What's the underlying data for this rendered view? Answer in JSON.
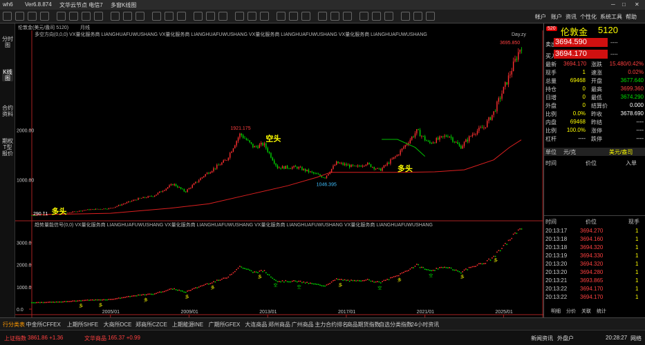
{
  "app": {
    "name": "wh6",
    "version": "Ver6.8.874",
    "menu": [
      "文华云节点 电信7",
      "多窗K线图"
    ],
    "window_controls": [
      "─",
      "□",
      "✕"
    ]
  },
  "toolbar": {
    "right_items": [
      "帐户",
      "账户",
      "资讯",
      "个性化",
      "系统工具",
      "帮助"
    ]
  },
  "left_tabs": [
    {
      "label": "分时图",
      "active": false
    },
    {
      "label": "K线图",
      "active": true
    },
    {
      "label": "合约资料",
      "active": false
    },
    {
      "label": "期权T型报价",
      "active": false
    }
  ],
  "chart_header": {
    "instrument": "伦敦金(美元/盎司 5120)",
    "period": "月线",
    "indicator_line": "多空方向(0,0,0)  VX量化服务商  LIANGHUAFUWUSHANG  VX量化服务商  LIANGHUAFUWUSHANG  VX量化服务商  LIANGHUAFUWUSHANG  VX量化服务商  LIANGHUAFUWUSHANG",
    "day_label": "Day.zy",
    "sub_indicator_line": "趋势量能信号(0,0)  VX量化服务商  LIANGHUAFUWUSHANG  VX量化服务商  LIANGHUAFUWUSHANG  VX量化服务商  LIANGHUAFUWUSHANG  VX量化服务商  LIANGHUAFUWUSHANG"
  },
  "chart_data": {
    "type": "candlestick",
    "title": "伦敦金 月线",
    "x_ticks": [
      "2005/01",
      "2009/01",
      "2013/01",
      "2017/01",
      "2021/01",
      "2025/01"
    ],
    "main_y_ticks": [
      1000.0,
      2000.0
    ],
    "sub_y_ticks": [
      0.0,
      1000.0,
      2000.0,
      3000.0
    ],
    "main_ylim": [
      290,
      3800
    ],
    "sub_ylim": [
      0,
      3600
    ],
    "x_range_years": [
      2001.0,
      2025.9
    ],
    "anchors": [
      [
        2001.0,
        290
      ],
      [
        2002.5,
        320
      ],
      [
        2003.8,
        400
      ],
      [
        2005.0,
        430
      ],
      [
        2006.4,
        620
      ],
      [
        2007.2,
        680
      ],
      [
        2008.2,
        920
      ],
      [
        2008.8,
        760
      ],
      [
        2009.8,
        1100
      ],
      [
        2010.9,
        1400
      ],
      [
        2011.6,
        1921.175
      ],
      [
        2012.3,
        1650
      ],
      [
        2012.8,
        1720
      ],
      [
        2013.5,
        1250
      ],
      [
        2014.5,
        1250
      ],
      [
        2015.9,
        1046.395
      ],
      [
        2016.5,
        1340
      ],
      [
        2017.5,
        1250
      ],
      [
        2018.0,
        1330
      ],
      [
        2018.7,
        1190
      ],
      [
        2019.6,
        1500
      ],
      [
        2020.6,
        1980
      ],
      [
        2021.2,
        1730
      ],
      [
        2022.2,
        1900
      ],
      [
        2022.8,
        1650
      ],
      [
        2023.5,
        1950
      ],
      [
        2024.0,
        2050
      ],
      [
        2024.5,
        2350
      ],
      [
        2025.2,
        3000
      ],
      [
        2025.7,
        3500
      ],
      [
        2025.9,
        3694.17
      ]
    ],
    "trailing_line": [
      [
        2001.0,
        300
      ],
      [
        2005.0,
        330
      ],
      [
        2008.0,
        430
      ],
      [
        2010.0,
        520
      ],
      [
        2012.0,
        700
      ],
      [
        2014.0,
        880
      ],
      [
        2015.5,
        1050
      ],
      [
        2016.2,
        1150
      ],
      [
        2020.0,
        1150
      ],
      [
        2021.5,
        1160
      ],
      [
        2023.0,
        1200
      ],
      [
        2024.5,
        1400
      ],
      [
        2025.3,
        1650
      ],
      [
        2025.9,
        1800
      ]
    ],
    "short_line": [
      [
        2018.8,
        1810
      ],
      [
        2019.6,
        1810
      ],
      [
        2020.5,
        1650
      ],
      [
        2021.0,
        1470
      ]
    ],
    "annotations": {
      "high_label": "1921.175",
      "low_label": "1046.395",
      "low_start_label": "290 †1",
      "peak_label": "3695.850",
      "short_signal": "空头",
      "long_signal_1": "多头",
      "long_signal_2": "多头"
    },
    "sub_markers": [
      "多",
      "空"
    ]
  },
  "quote": {
    "badge": "520",
    "name": "伦敦金",
    "code": "5120",
    "sell_label": "卖出",
    "sell_price": "3694.590",
    "sell_vol": "----",
    "buy_label": "买入",
    "buy_price": "3694.170",
    "buy_vol": "----",
    "rows": [
      {
        "l1": "最新",
        "v1": "3694.170",
        "c1": "#ff4040",
        "l2": "涨跌",
        "v2": "15.480/0.42%",
        "c2": "#ff4040"
      },
      {
        "l1": "现手",
        "v1": "1",
        "c1": "#ffff00",
        "l2": "速涨",
        "v2": "0.02%",
        "c2": "#ff4040"
      },
      {
        "l1": "总量",
        "v1": "69468",
        "c1": "#ffff00",
        "l2": "开盘",
        "v2": "3677.640",
        "c2": "#00e000"
      },
      {
        "l1": "持仓",
        "v1": "0",
        "c1": "#ffff00",
        "l2": "最高",
        "v2": "3699.360",
        "c2": "#ff4040"
      },
      {
        "l1": "日增",
        "v1": "0",
        "c1": "#ffff00",
        "l2": "最低",
        "v2": "3674.290",
        "c2": "#00e000"
      },
      {
        "l1": "外盘",
        "v1": "0",
        "c1": "#ffff00",
        "l2": "结算价",
        "v2": "0.000",
        "c2": "#ffffff"
      },
      {
        "l1": "比例",
        "v1": "0.0%",
        "c1": "#ffff00",
        "l2": "昨收",
        "v2": "3678.690",
        "c2": "#ffffff"
      },
      {
        "l1": "内盘",
        "v1": "69468",
        "c1": "#ffff00",
        "l2": "昨结",
        "v2": "----",
        "c2": "#ffffff"
      },
      {
        "l1": "比例",
        "v1": "100.0%",
        "c1": "#ffff00",
        "l2": "涨停",
        "v2": "----",
        "c2": "#ffffff"
      },
      {
        "l1": "杠杆",
        "v1": "----",
        "c1": "#ffffff",
        "l2": "跌停",
        "v2": "----",
        "c2": "#ffffff"
      }
    ],
    "unit_label": "单位",
    "unit_value": "元/克",
    "unit_value2": "美元/盎司",
    "panel_headers": [
      "时间",
      "价位",
      "入单"
    ],
    "tick_headers": [
      "时间",
      "价位",
      "现手"
    ],
    "ticks": [
      {
        "time": "20:13:17",
        "price": "3694.270",
        "vol": "1"
      },
      {
        "time": "20:13:18",
        "price": "3694.160",
        "vol": "1"
      },
      {
        "time": "20:13:18",
        "price": "3694.320",
        "vol": "1"
      },
      {
        "time": "20:13:19",
        "price": "3694.330",
        "vol": "1"
      },
      {
        "time": "20:13:20",
        "price": "3694.320",
        "vol": "1"
      },
      {
        "time": "20:13:20",
        "price": "3694.280",
        "vol": "1"
      },
      {
        "time": "20:13:21",
        "price": "3693.865",
        "vol": "1"
      },
      {
        "time": "20:13:22",
        "price": "3694.170",
        "vol": "1"
      },
      {
        "time": "20:13:22",
        "price": "3694.170",
        "vol": "1"
      }
    ],
    "bottom_tabs": [
      "明细",
      "分价",
      "关联",
      "统计"
    ]
  },
  "bottom_tabs": [
    "行分类表",
    "中金所CFFEX",
    "上期所SHFE",
    "大商所DCE",
    "郑商所CZCE",
    "上期能源INE",
    "广期所GFEX",
    "大连商品",
    "郑州商品",
    "广州商品",
    "主力合约排名",
    "商品期货指数",
    "自选分类指数",
    "24小时资讯"
  ],
  "status": {
    "index1_name": "上证指数",
    "index1_value": "3861.86 +1.36",
    "index2_name": "文华商品",
    "index2_value": "165.37 +0.99",
    "buttons": [
      "新闻资讯",
      "外盘户"
    ],
    "clock": "20:28:27",
    "network": "网络"
  },
  "colors": {
    "up": "#ff3030",
    "down": "#00d800",
    "axis": "#aa2222",
    "signal_yellow": "#ffff00",
    "quote_yellow": "#ffff00",
    "accent_orange": "#ff9900"
  }
}
